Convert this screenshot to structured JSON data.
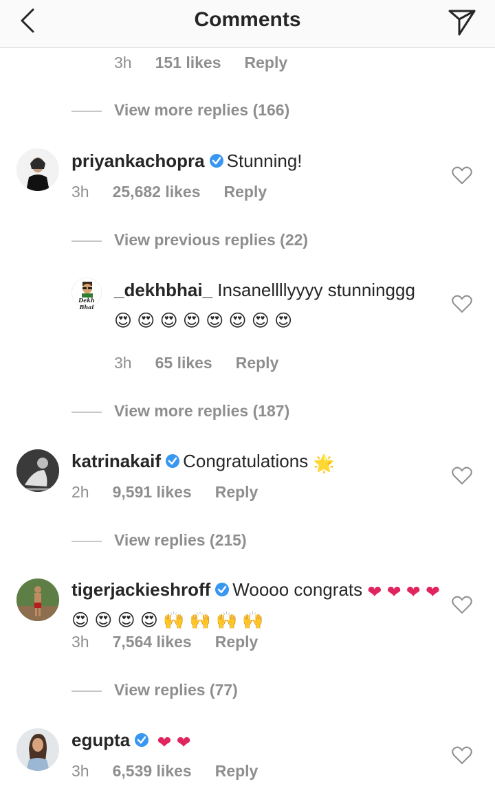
{
  "header": {
    "title": "Comments"
  },
  "top_meta": {
    "time": "3h",
    "likes": "151 likes",
    "reply": "Reply"
  },
  "view_more_1": "View more replies (166)",
  "comments": [
    {
      "user": "priyankachopra",
      "text": "Stunning!",
      "time": "3h",
      "likes": "25,682 likes",
      "reply": "Reply"
    },
    {
      "user": "katrinakaif",
      "text": "Congratulations",
      "time": "2h",
      "likes": "9,591 likes",
      "reply": "Reply"
    },
    {
      "user": "tigerjackieshroff",
      "text": "Woooo congrats",
      "time": "3h",
      "likes": "7,564 likes",
      "reply": "Reply"
    },
    {
      "user": "egupta",
      "text": "",
      "time": "3h",
      "likes": "6,539 likes",
      "reply": "Reply"
    }
  ],
  "view_previous": "View previous replies (22)",
  "reply_1": {
    "user": "_dekhbhai_",
    "text": "Insanellllyyyy stunninggg",
    "time": "3h",
    "likes": "65 likes",
    "reply": "Reply",
    "avatar_label": "Dekh Bhai"
  },
  "view_more_2": "View more replies (187)",
  "view_replies_1": "View replies (215)",
  "view_replies_2": "View replies (77)",
  "icons": {
    "back": "chevron-left-icon",
    "send": "paper-plane-icon",
    "like": "heart-outline-icon",
    "verified": "verified-badge-icon"
  },
  "colors": {
    "verified": "#3897f0",
    "heart": "#e0245e",
    "emoji_face": "#f7c325",
    "muted_text": "#8e8e8e"
  }
}
